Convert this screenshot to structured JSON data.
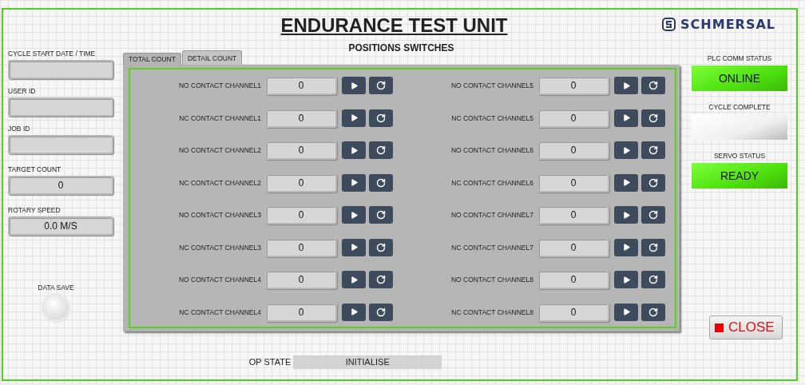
{
  "title": "ENDURANCE TEST UNIT",
  "logo": {
    "text": "SCHMERSAL"
  },
  "left_fields": [
    {
      "label": "CYCLE START DATE / TIME"
    },
    {
      "label": "USER ID"
    },
    {
      "label": "JOB ID"
    },
    {
      "label": "TARGET COUNT",
      "value": "0"
    },
    {
      "label": "ROTARY SPEED",
      "value": "0.0 M/S"
    }
  ],
  "data_save": {
    "label": "DATA SAVE",
    "on": false
  },
  "subtitle": "POSITIONS SWITCHES",
  "tabs": [
    {
      "label": "TOTAL COUNT",
      "selected": false
    },
    {
      "label": "DETAIL COUNT",
      "selected": true
    }
  ],
  "channel_columns": [
    [
      {
        "label": "NO CONTACT CHANNEL1",
        "value": "0"
      },
      {
        "label": "NC CONTACT CHANNEL1",
        "value": "0"
      },
      {
        "label": "NO CONTACT CHANNEL2",
        "value": "0"
      },
      {
        "label": "NC CONTACT CHANNEL2",
        "value": "0"
      },
      {
        "label": "NO CONTACT CHANNEL3",
        "value": "0"
      },
      {
        "label": "NC CONTACT CHANNEL3",
        "value": "0"
      },
      {
        "label": "NO CONTACT CHANNEL4",
        "value": "0"
      },
      {
        "label": "NC CONTACT CHANNEL4",
        "value": "0"
      }
    ],
    [
      {
        "label": "NO CONTACT CHANNEL5",
        "value": "0"
      },
      {
        "label": "NC CONTACT CHANNEL5",
        "value": "0"
      },
      {
        "label": "NO CONTACT CHANNEL6",
        "value": "0"
      },
      {
        "label": "NC CONTACT CHANNEL6",
        "value": "0"
      },
      {
        "label": "NO CONTACT CHANNEL7",
        "value": "0"
      },
      {
        "label": "NC CONTACT CHANNEL7",
        "value": "0"
      },
      {
        "label": "NO CONTACT CHANNEL8",
        "value": "0"
      },
      {
        "label": "NC CONTACT CHANNEL8",
        "value": "0"
      }
    ]
  ],
  "status_indicators": [
    {
      "label": "PLC COMM STATUS",
      "text": "ONLINE",
      "on": true
    },
    {
      "label": "CYCLE COMPLETE",
      "on": false
    },
    {
      "label": "SERVO STATUS",
      "text": "READY",
      "on": true
    }
  ],
  "close_button": {
    "label": "CLOSE"
  },
  "op_state": {
    "label": "OP STATE",
    "value": "INITIALISE"
  }
}
